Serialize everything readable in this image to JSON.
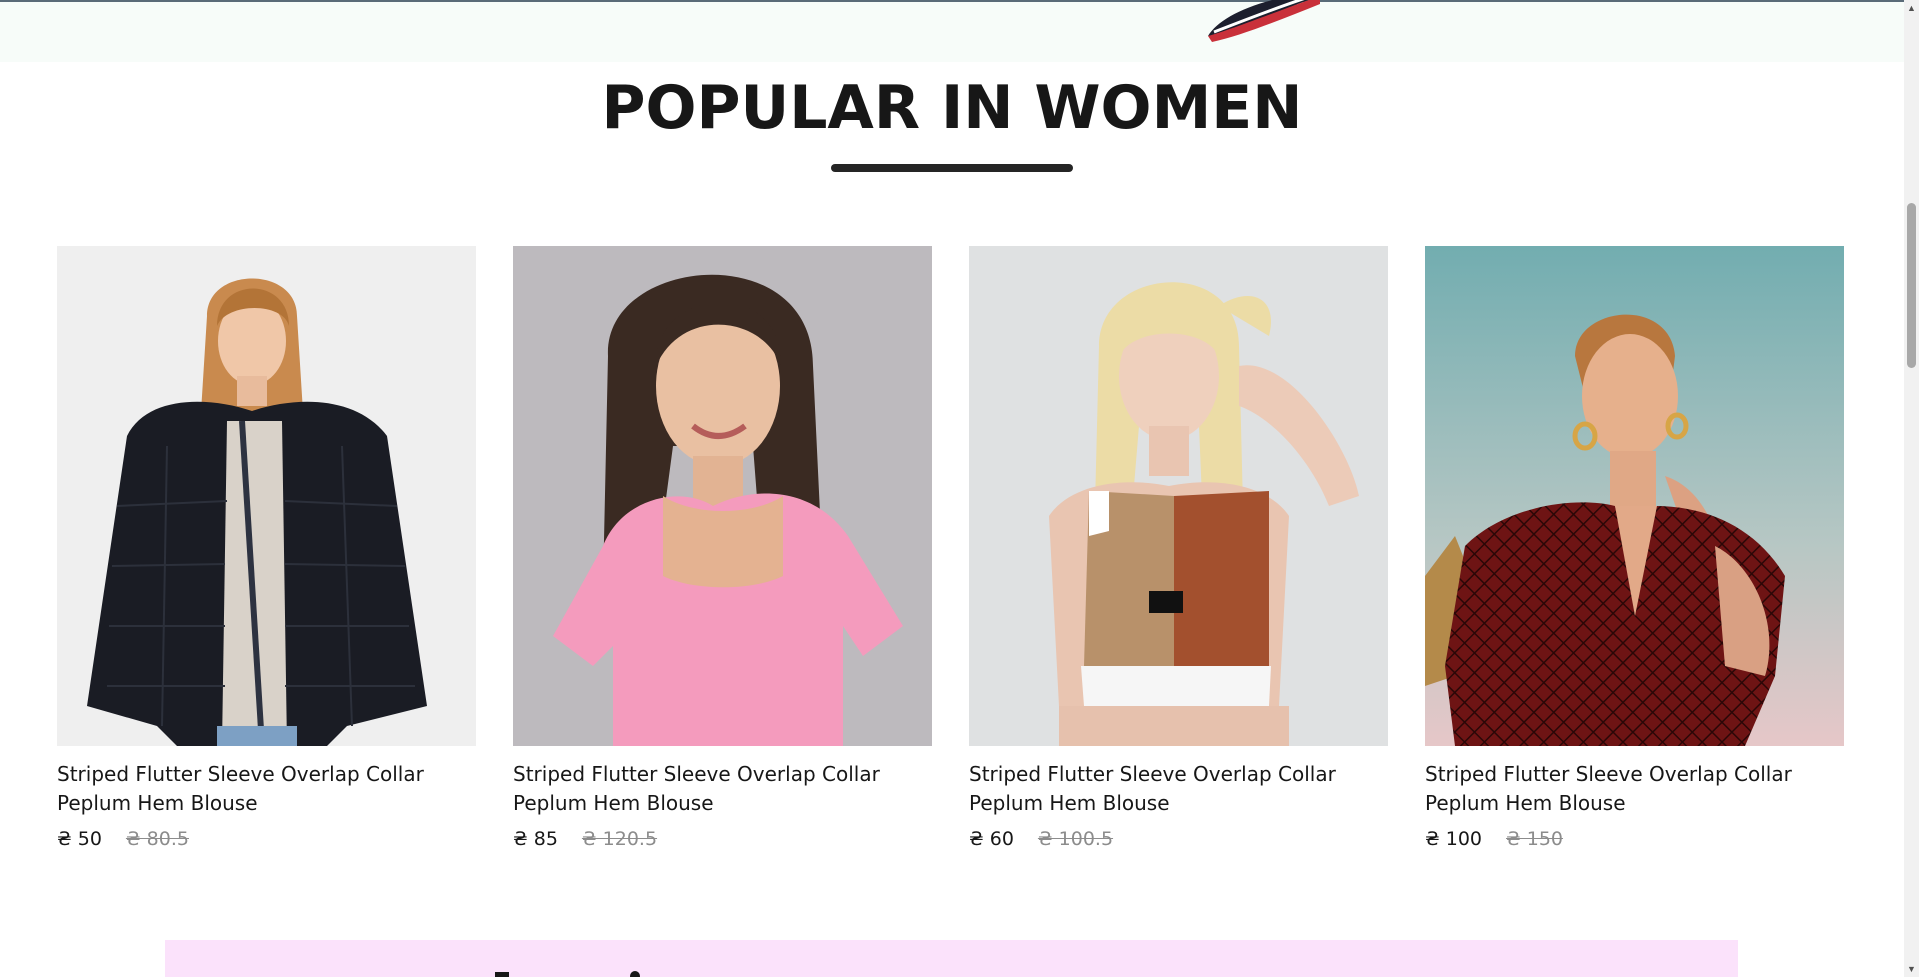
{
  "section": {
    "title": "POPULAR IN WOMEN"
  },
  "products": [
    {
      "name": "Striped Flutter Sleeve Overlap Collar Peplum Hem Blouse",
      "price_new": "₴ 50",
      "price_old": "₴ 80.5",
      "image": "woman-black-fur-jacket"
    },
    {
      "name": "Striped Flutter Sleeve Overlap Collar Peplum Hem Blouse",
      "price_new": "₴ 85",
      "price_old": "₴ 120.5",
      "image": "woman-pink-top"
    },
    {
      "name": "Striped Flutter Sleeve Overlap Collar Peplum Hem Blouse",
      "price_new": "₴ 60",
      "price_old": "₴ 100.5",
      "image": "woman-sports-crop-top"
    },
    {
      "name": "Striped Flutter Sleeve Overlap Collar Peplum Hem Blouse",
      "price_new": "₴ 100",
      "price_old": "₴ 150",
      "image": "woman-red-patterned-blouse"
    }
  ],
  "colors": {
    "text": "#171717",
    "old_price": "#8c8c8c",
    "banner_bottom": "#fbe2fb",
    "banner_top": "#f7fcf9"
  }
}
